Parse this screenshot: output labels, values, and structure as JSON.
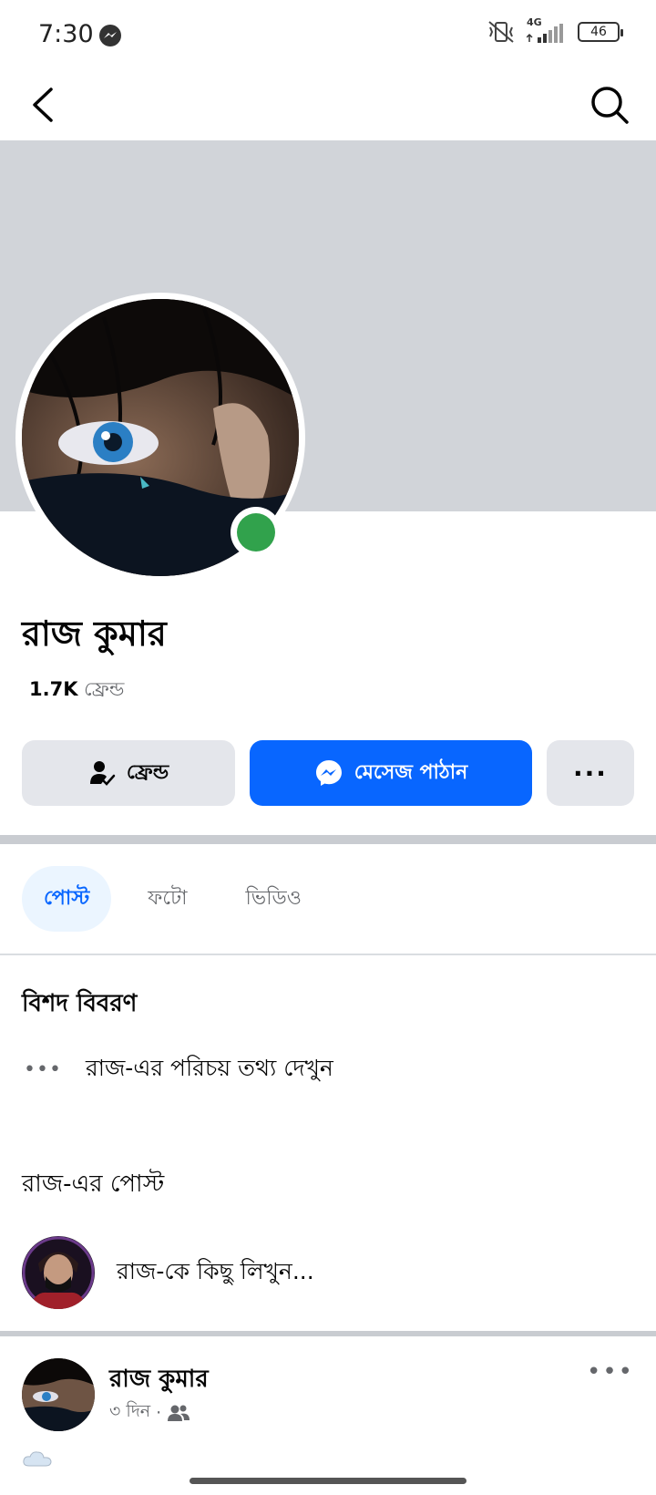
{
  "status_bar": {
    "time": "7:30",
    "network": "4G",
    "battery": "46"
  },
  "profile": {
    "name": "রাজ কুমার",
    "friends_count": "1.7K",
    "friends_label": "ফ্রেন্ড",
    "online": true
  },
  "actions": {
    "friend_label": "ফ্রেন্ড",
    "message_label": "মেসেজ পাঠান",
    "more_label": "···"
  },
  "tabs": [
    {
      "label": "পোস্ট",
      "active": true
    },
    {
      "label": "ফটো",
      "active": false
    },
    {
      "label": "ভিডিও",
      "active": false
    }
  ],
  "details": {
    "title": "বিশদ বিবরণ",
    "about_link": "রাজ-এর পরিচয় তথ্য দেখুন"
  },
  "posts_section": {
    "title": "রাজ-এর পোস্ট",
    "composer_placeholder": "রাজ-কে কিছু লিখুন..."
  },
  "post": {
    "author": "রাজ কুমার",
    "time": "৩ দিন",
    "separator": "·",
    "audience_icon": "friends-icon"
  },
  "colors": {
    "accent": "#0866ff",
    "online": "#31a24c",
    "cover": "#d1d4d9",
    "button_gray": "#e4e6eb"
  }
}
